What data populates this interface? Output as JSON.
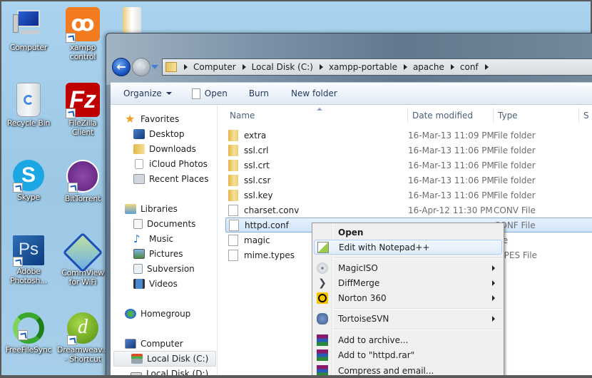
{
  "desktop": {
    "icons": [
      {
        "label": "Computer",
        "icon": "computer-icon",
        "shortcut": false
      },
      {
        "label": "xampp control",
        "icon": "xampp-icon",
        "shortcut": true
      },
      {
        "label": "Recycle Bin",
        "icon": "recycle-bin-icon",
        "shortcut": false
      },
      {
        "label": "FileZilla Client",
        "icon": "filezilla-icon",
        "shortcut": true
      },
      {
        "label": "Skype",
        "icon": "skype-icon",
        "shortcut": true
      },
      {
        "label": "BitTorrent",
        "icon": "bittorrent-icon",
        "shortcut": true
      },
      {
        "label": "Adobe Photosh...",
        "icon": "photoshop-icon",
        "shortcut": true
      },
      {
        "label": "CommView for WiFi",
        "icon": "commview-icon",
        "shortcut": true
      },
      {
        "label": "FreeFileSync",
        "icon": "freefilesync-icon",
        "shortcut": true
      },
      {
        "label": "Dreamweav... - Shortcut",
        "icon": "dreamweaver-icon",
        "shortcut": true
      }
    ]
  },
  "explorer": {
    "breadcrumb": [
      "Computer",
      "Local Disk (C:)",
      "xampp-portable",
      "apache",
      "conf"
    ],
    "toolbar": {
      "organize": "Organize",
      "open": "Open",
      "burn": "Burn",
      "new_folder": "New folder"
    },
    "nav": {
      "favorites": {
        "label": "Favorites",
        "items": [
          "Desktop",
          "Downloads",
          "iCloud Photos",
          "Recent Places"
        ]
      },
      "libraries": {
        "label": "Libraries",
        "items": [
          "Documents",
          "Music",
          "Pictures",
          "Subversion",
          "Videos"
        ]
      },
      "homegroup": "Homegroup",
      "computer": {
        "label": "Computer",
        "items": [
          "Local Disk (C:)",
          "Local Disk (D:)"
        ]
      }
    },
    "columns": {
      "name": "Name",
      "date": "Date modified",
      "type": "Type",
      "size": "S"
    },
    "files": [
      {
        "name": "extra",
        "date": "16-Mar-13 11:09 PM",
        "type": "File folder",
        "kind": "folder"
      },
      {
        "name": "ssl.crl",
        "date": "16-Mar-13 11:06 PM",
        "type": "File folder",
        "kind": "folder"
      },
      {
        "name": "ssl.crt",
        "date": "16-Mar-13 11:06 PM",
        "type": "File folder",
        "kind": "folder"
      },
      {
        "name": "ssl.csr",
        "date": "16-Mar-13 11:06 PM",
        "type": "File folder",
        "kind": "folder"
      },
      {
        "name": "ssl.key",
        "date": "16-Mar-13 11:06 PM",
        "type": "File folder",
        "kind": "folder"
      },
      {
        "name": "charset.conv",
        "date": "16-Apr-12 11:30 PM",
        "type": "CONV File",
        "kind": "file"
      },
      {
        "name": "httpd.conf",
        "date": "",
        "type": "CONF File",
        "kind": "file",
        "selected": true
      },
      {
        "name": "magic",
        "date": "",
        "type": "File",
        "kind": "file"
      },
      {
        "name": "mime.types",
        "date": "",
        "type": "TYPES File",
        "kind": "file"
      }
    ]
  },
  "context_menu": {
    "items": [
      {
        "label": "Open",
        "bold": true
      },
      {
        "label": "Edit with Notepad++",
        "icon": "notepadpp-icon",
        "highlighted": true
      },
      {
        "label": "MagicISO",
        "icon": "magiciso-icon",
        "submenu": true
      },
      {
        "label": "DiffMerge",
        "icon": "diffmerge-icon",
        "submenu": true
      },
      {
        "label": "Norton 360",
        "icon": "norton-icon",
        "submenu": true
      },
      {
        "label": "TortoiseSVN",
        "icon": "tortoisesvn-icon",
        "submenu": true
      },
      {
        "label": "Add to archive...",
        "icon": "winrar-icon"
      },
      {
        "label": "Add to \"httpd.rar\"",
        "icon": "winrar-icon"
      },
      {
        "label": "Compress and email...",
        "icon": "winrar-icon"
      }
    ]
  }
}
